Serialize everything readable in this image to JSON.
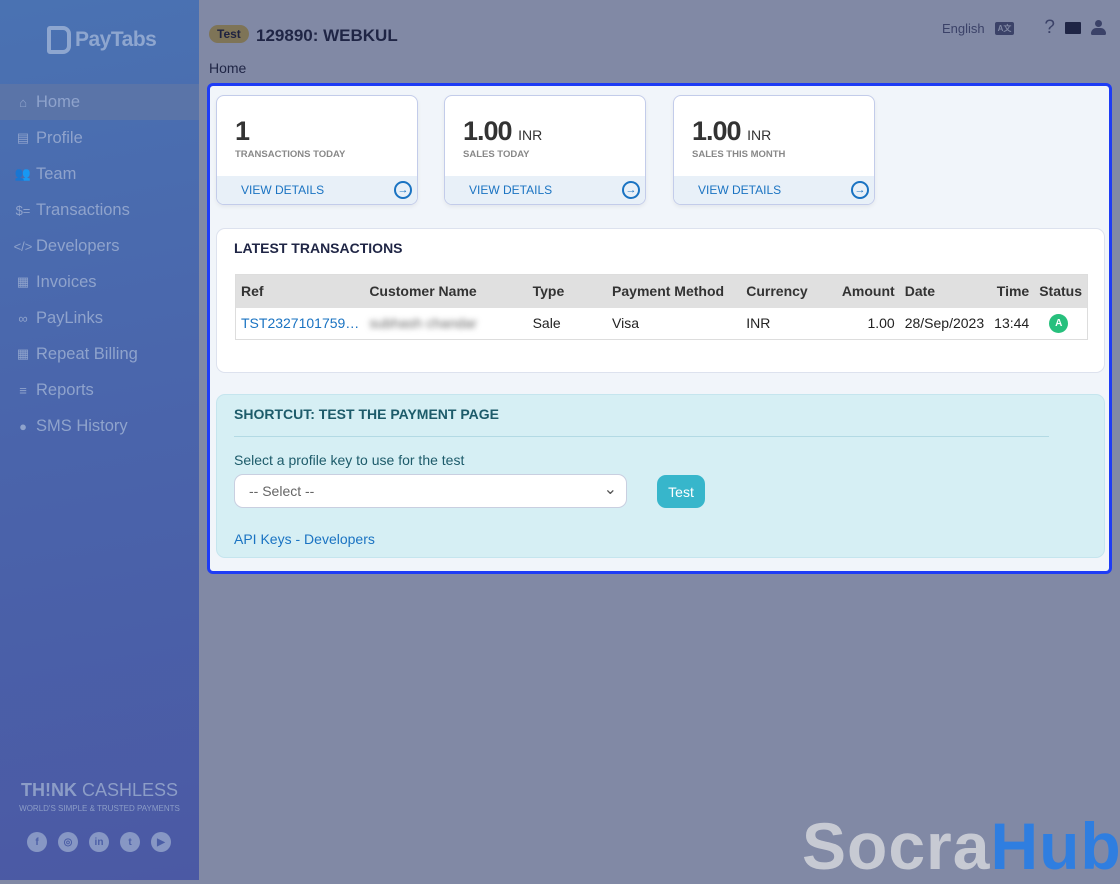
{
  "brand": {
    "name": "PayTabs",
    "tagline_bold": "TH!NK",
    "tagline_rest": "CASHLESS",
    "subtagline": "WORLD'S SIMPLE & TRUSTED PAYMENTS"
  },
  "sidebar": {
    "items": [
      {
        "label": "Home",
        "icon": "⌂"
      },
      {
        "label": "Profile",
        "icon": "▤"
      },
      {
        "label": "Team",
        "icon": "👥"
      },
      {
        "label": "Transactions",
        "icon": "$="
      },
      {
        "label": "Developers",
        "icon": "</>"
      },
      {
        "label": "Invoices",
        "icon": "▦"
      },
      {
        "label": "PayLinks",
        "icon": "∞"
      },
      {
        "label": "Repeat Billing",
        "icon": "▦"
      },
      {
        "label": "Reports",
        "icon": "≡"
      },
      {
        "label": "SMS History",
        "icon": "●"
      }
    ]
  },
  "social": [
    "f",
    "◎",
    "in",
    "t",
    "▶"
  ],
  "header": {
    "badge": "Test",
    "title": "129890: WEBKUL",
    "breadcrumb": "Home",
    "language": "English",
    "lang_icon": "A文",
    "help": "?"
  },
  "stats": [
    {
      "value": "1",
      "unit": "",
      "label": "TRANSACTIONS TODAY",
      "link": "VIEW DETAILS"
    },
    {
      "value": "1.00",
      "unit": "INR",
      "label": "SALES TODAY",
      "link": "VIEW DETAILS"
    },
    {
      "value": "1.00",
      "unit": "INR",
      "label": "SALES THIS MONTH",
      "link": "VIEW DETAILS"
    }
  ],
  "latest": {
    "title": "LATEST TRANSACTIONS",
    "columns": [
      "Ref",
      "Customer Name",
      "Type",
      "Payment Method",
      "Currency",
      "Amount",
      "Date",
      "Time",
      "Status"
    ],
    "rows": [
      {
        "ref": "TST2327101759…",
        "customer": "subhash chandar",
        "type": "Sale",
        "method": "Visa",
        "currency": "INR",
        "amount": "1.00",
        "date": "28/Sep/2023",
        "time": "13:44",
        "status": "A"
      }
    ]
  },
  "shortcut": {
    "title": "SHORTCUT: TEST THE PAYMENT PAGE",
    "prompt": "Select a profile key to use for the test",
    "select_value": "-- Select --",
    "button": "Test",
    "link1": "API Keys",
    "sep": " - ",
    "link2": "Developers"
  },
  "watermark": {
    "part1": "Socra",
    "part2": "Hub"
  },
  "colors": {
    "accent": "#1e3cf5",
    "link": "#1a73c2",
    "status_ok": "#27c07d",
    "button": "#37b6cb"
  }
}
